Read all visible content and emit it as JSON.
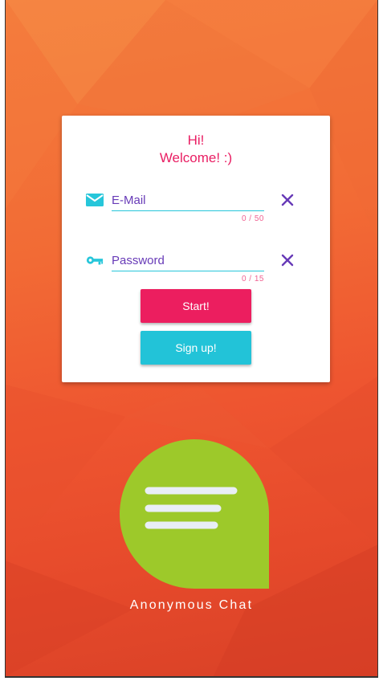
{
  "login_card": {
    "greeting_line1": "Hi!",
    "greeting_line2": "Welcome! :)",
    "email": {
      "placeholder": "E-Mail",
      "value": "",
      "counter": "0 / 50",
      "icon": "envelope-icon"
    },
    "password": {
      "placeholder": "Password",
      "value": "",
      "counter": "0 / 15",
      "icon": "key-icon"
    },
    "start_label": "Start!",
    "signup_label": "Sign up!"
  },
  "branding": {
    "app_name": "Anonymous Chat",
    "logo_icon": "chat-bubble-icon"
  },
  "colors": {
    "accent_pink": "#ec1e5f",
    "accent_cyan": "#22c3d8",
    "text_purple": "#673ab7",
    "logo_green": "#9dc92a",
    "background_orange": "#ee5530"
  }
}
